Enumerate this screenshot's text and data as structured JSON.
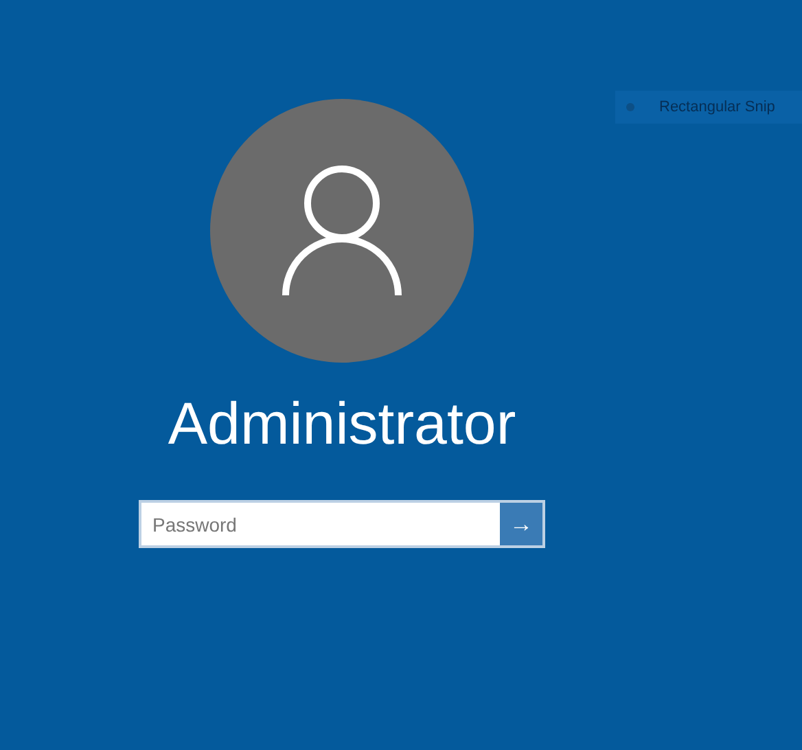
{
  "user": {
    "name": "Administrator"
  },
  "password": {
    "placeholder": "Password"
  },
  "submit": {
    "label": "→"
  },
  "snip_toolbar": {
    "label": "Rectangular Snip"
  }
}
